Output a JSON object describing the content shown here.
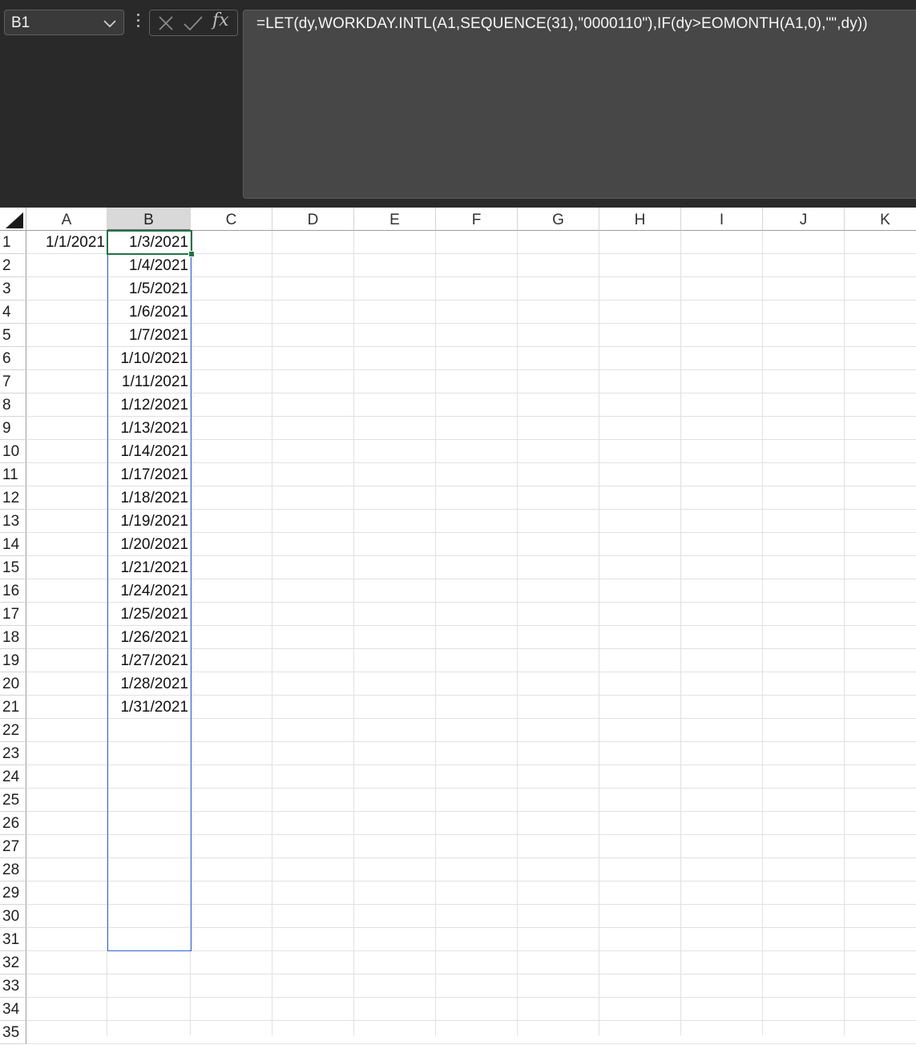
{
  "formula_bar": {
    "name_box": "B1",
    "formula": "=LET(dy,WORKDAY.INTL(A1,SEQUENCE(31),\"0000110\"),IF(dy>EOMONTH(A1,0),\"\",dy))",
    "fx_label": "fx",
    "icons": [
      "chevron-down-icon",
      "more-options-icon",
      "cancel-icon",
      "check-icon",
      "function-icon"
    ]
  },
  "columns": [
    "A",
    "B",
    "C",
    "D",
    "E",
    "F",
    "G",
    "H",
    "I",
    "J",
    "K"
  ],
  "selected_column": "B",
  "rows": [
    "1",
    "2",
    "3",
    "4",
    "5",
    "6",
    "7",
    "8",
    "9",
    "10",
    "11",
    "12",
    "13",
    "14",
    "15",
    "16",
    "17",
    "18",
    "19",
    "20",
    "21",
    "22",
    "23",
    "24",
    "25",
    "26",
    "27",
    "28",
    "29",
    "30",
    "31",
    "32",
    "33",
    "34",
    "35"
  ],
  "cells": {
    "A1": "1/1/2021",
    "B": [
      "1/3/2021",
      "1/4/2021",
      "1/5/2021",
      "1/6/2021",
      "1/7/2021",
      "1/10/2021",
      "1/11/2021",
      "1/12/2021",
      "1/13/2021",
      "1/14/2021",
      "1/17/2021",
      "1/18/2021",
      "1/19/2021",
      "1/20/2021",
      "1/21/2021",
      "1/24/2021",
      "1/25/2021",
      "1/26/2021",
      "1/27/2021",
      "1/28/2021",
      "1/31/2021"
    ]
  },
  "active_cell": "B1",
  "spill_range": "B1:B31",
  "colors": {
    "active_border": "#217346",
    "spill_border": "#2e62d6",
    "header_selected": "#d9d9d9"
  }
}
